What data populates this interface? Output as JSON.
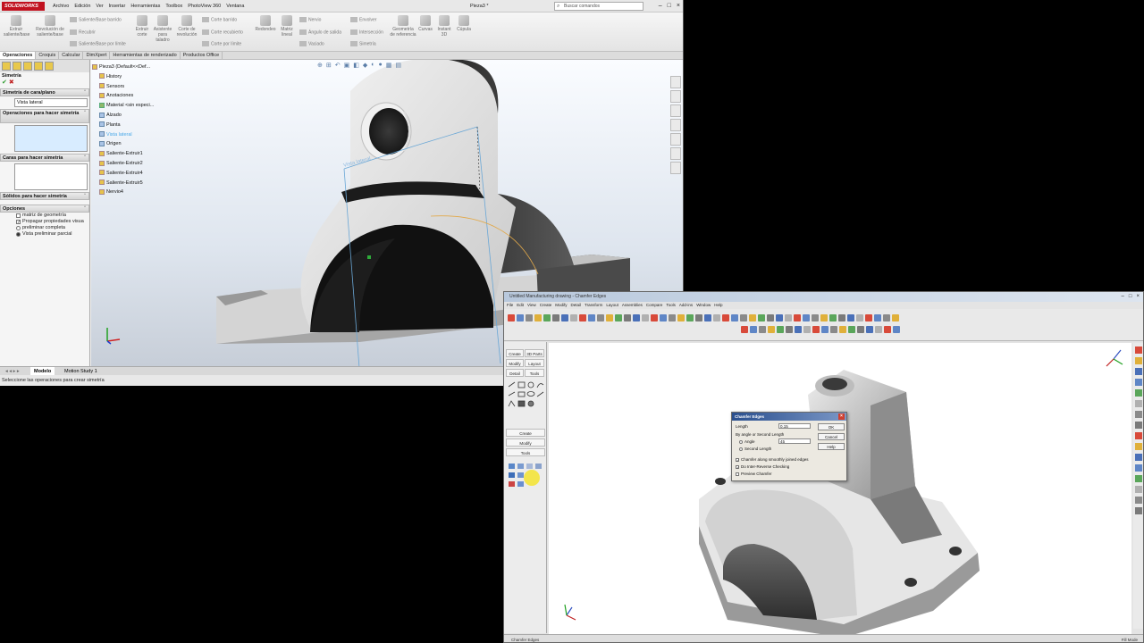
{
  "solidworks": {
    "logo_text": "SOLIDWORKS",
    "menu": [
      "Archivo",
      "Edición",
      "Ver",
      "Insertar",
      "Herramientas",
      "Toolbox",
      "PhotoView 360",
      "Ventana"
    ],
    "doc_title": "Pieza3 *",
    "search_placeholder": "Buscar comandos",
    "ribbon": {
      "extrude_boss": "Extruir saliente/base",
      "revolve_boss": "Revolución de saliente/base",
      "swept_boss": "Saliente/Base barrido",
      "loft_boss": "Recubrir",
      "boundary_boss": "Saliente/Base por límite",
      "extrude_cut": "Extruir corte",
      "hole_wizard": "Asistente para taladro",
      "revolve_cut": "Corte de revolución",
      "swept_cut": "Corte barrido",
      "loft_cut": "Corte recubierto",
      "boundary_cut": "Corte por límite",
      "fillet": "Redondeo",
      "linear_pattern": "Matriz lineal",
      "rib": "Nervio",
      "draft": "Ángulo de salida",
      "shell": "Vaciado",
      "wrap": "Envolver",
      "intersect": "Intersección",
      "mirror": "Simetría",
      "ref_geometry": "Geometría de referencia",
      "curves": "Curvas",
      "instant3d": "Instant 3D",
      "dome": "Cúpula"
    },
    "tabs": [
      "Operaciones",
      "Croquis",
      "Calcular",
      "DimXpert",
      "Herramientas de renderizado",
      "Productos Office"
    ],
    "property_manager": {
      "title": "Simetría",
      "face_plane_header": "Simetría de cara/plano",
      "face_plane_value": "Vista lateral",
      "features_header": "Operaciones para hacer simetría",
      "faces_header": "Caras para hacer simetría",
      "bodies_header": "Sólidos para hacer simetría",
      "options_header": "Opciones",
      "options": [
        {
          "label": "matriz de geometría",
          "checked": false
        },
        {
          "label": "Propagar propiedades visua",
          "checked": true
        },
        {
          "label": "preliminar completa",
          "checked": false
        },
        {
          "label": "Vista preliminar parcial",
          "checked": true
        }
      ]
    },
    "tree": {
      "root": "Pieza3  (Default<<Def...",
      "items": [
        {
          "label": "History",
          "type": "folder"
        },
        {
          "label": "Sensors",
          "type": "folder"
        },
        {
          "label": "Anotaciones",
          "type": "folder"
        },
        {
          "label": "Material <sin especi...",
          "type": "material"
        },
        {
          "label": "Alzado",
          "type": "plane"
        },
        {
          "label": "Planta",
          "type": "plane"
        },
        {
          "label": "Vista lateral",
          "type": "plane-selected"
        },
        {
          "label": "Origen",
          "type": "origin"
        },
        {
          "label": "Saliente-Extruir1",
          "type": "feature"
        },
        {
          "label": "Saliente-Extruir2",
          "type": "feature"
        },
        {
          "label": "Saliente-Extruir4",
          "type": "feature"
        },
        {
          "label": "Saliente-Extruir5",
          "type": "feature"
        },
        {
          "label": "Nervio4",
          "type": "feature"
        }
      ]
    },
    "viewport_label": "Vista lateral",
    "bottom_tabs": [
      "Modelo",
      "Motion Study 1"
    ],
    "status_text": "Seleccione las operaciones para crear simetría"
  },
  "turbocad": {
    "title": "Untitled Manufacturing drawing - Chamfer Edges",
    "menu": [
      "File",
      "Edit",
      "View",
      "Create",
      "Modify",
      "Detail",
      "Transform",
      "Layout",
      "Assemblies",
      "Compare",
      "Tools",
      "Add-ins",
      "Window",
      "Help"
    ],
    "left_tabs": [
      "Create",
      "Modify",
      "Detail",
      "Tools",
      "3D Parts"
    ],
    "left_tabs2": [
      "Create",
      "Modify",
      "Tools"
    ],
    "dialog": {
      "title": "Chamfer Edges",
      "length_label": "Length",
      "length_value": "0.15",
      "by_angle_label": "By angle or Second Length",
      "angle_label": "Angle",
      "angle_value": "45",
      "second_length_label": "Second Length",
      "chain_label": "Chamfer along smoothly joined edges",
      "check_label": "Do Inter-Reverse Checking",
      "preview_label": "Preview Chamfer",
      "ok": "OK",
      "cancel": "Cancel",
      "help": "Help"
    },
    "status_text": "Chamfer Edges",
    "status_right": "Fill Mode"
  },
  "colors": {
    "sw_red": "#c1121f",
    "sw_tab_blue": "#4aa9e8",
    "tc_title_blue": "#2a4f8e",
    "highlight_yellow": "#f4e43a"
  }
}
